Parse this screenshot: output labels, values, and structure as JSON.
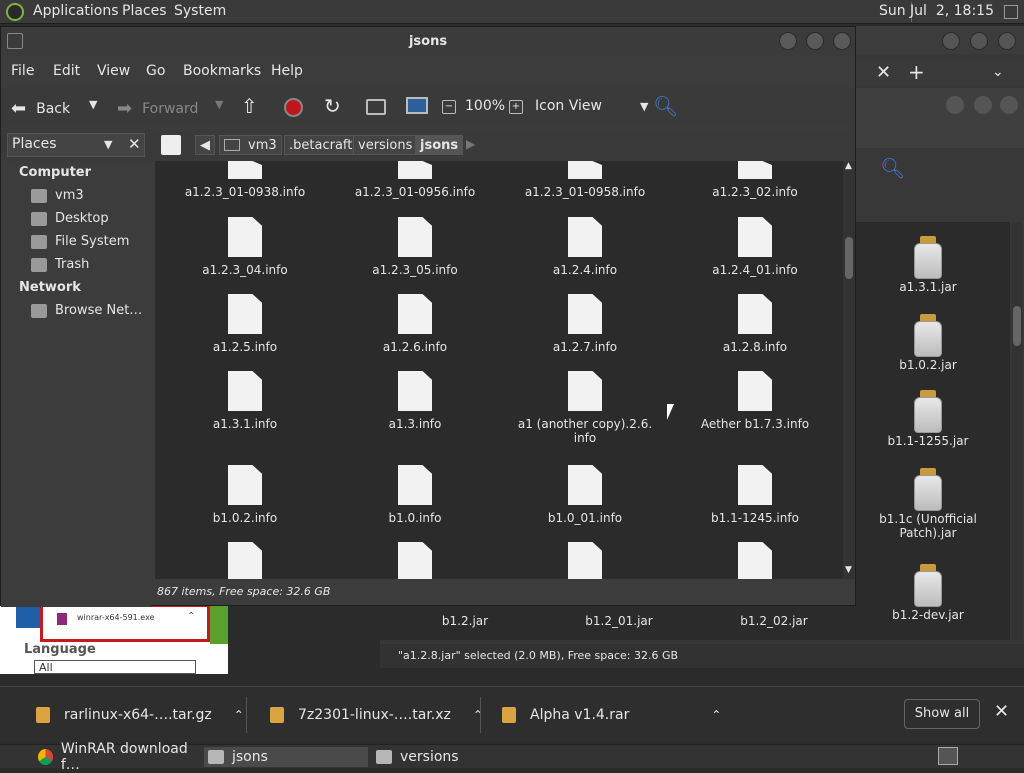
{
  "top_panel": {
    "menus": [
      "Applications",
      "Places",
      "System"
    ],
    "clock": "Sun Jul  2, 18:15"
  },
  "window": {
    "title": "jsons",
    "menubar": [
      "File",
      "Edit",
      "View",
      "Go",
      "Bookmarks",
      "Help"
    ],
    "toolbar": {
      "back": "Back",
      "forward": "Forward",
      "zoom": "100%",
      "view_mode": "Icon View"
    },
    "sidebar_mode": "Places",
    "breadcrumbs": [
      "vm3",
      ".betacraft",
      "versions",
      "jsons"
    ],
    "sidebar": {
      "computer_header": "Computer",
      "computer_items": [
        "vm3",
        "Desktop",
        "File System",
        "Trash"
      ],
      "network_header": "Network",
      "network_items": [
        "Browse Net…"
      ]
    },
    "files": [
      "a1.2.3_01-0938.info",
      "a1.2.3_01-0956.info",
      "a1.2.3_01-0958.info",
      "a1.2.3_02.info",
      "a1.2.3_04.info",
      "a1.2.3_05.info",
      "a1.2.4.info",
      "a1.2.4_01.info",
      "a1.2.5.info",
      "a1.2.6.info",
      "a1.2.7.info",
      "a1.2.8.info",
      "a1.3.1.info",
      "a1.3.info",
      "a1 (another copy).2.6.\ninfo",
      "Aether b1.7.3.info",
      "b1.0.2.info",
      "b1.0.info",
      "b1.0_01.info",
      "b1.1-1245.info"
    ],
    "status": "867 items, Free space: 32.6 GB"
  },
  "bg_window": {
    "jars_right": [
      "a1.3.1.jar",
      "b1.0.2.jar",
      "b1.1-1255.jar",
      "b1.1c (Unofficial\nPatch).jar",
      "b1.2-dev.jar"
    ],
    "jars_bottom": [
      "b1.2.jar",
      "b1.2_01.jar",
      "b1.2_02.jar"
    ],
    "status": "\"a1.2.8.jar\" selected (2.0 MB), Free space: 32.6 GB"
  },
  "browser": {
    "download_file": "winrar-x64-591.exe",
    "language_label": "Language",
    "language_value": "All"
  },
  "downloads": {
    "items": [
      "rarlinux-x64-….tar.gz",
      "7z2301-linux-….tar.xz",
      "Alpha v1.4.rar"
    ],
    "show_all": "Show all"
  },
  "taskbar": {
    "tasks": [
      "WinRAR download f…",
      "jsons",
      "versions"
    ]
  },
  "colors": {
    "accent_green": "#7fb241",
    "folder_tan": "#d9a441",
    "record_red": "#c0151c"
  }
}
